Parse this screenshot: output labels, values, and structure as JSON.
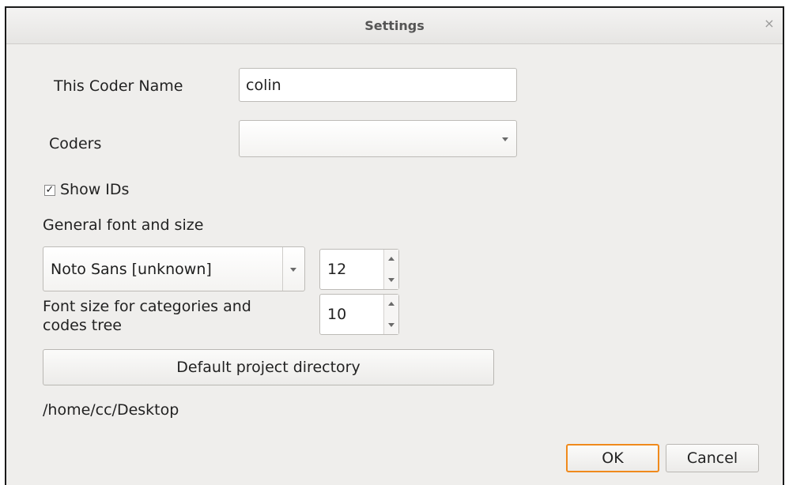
{
  "window": {
    "title": "Settings",
    "close_glyph": "×"
  },
  "coder_name": {
    "label": "This Coder Name",
    "value": "colin"
  },
  "coders": {
    "label": "Coders",
    "selected": ""
  },
  "show_ids": {
    "label": "Show IDs",
    "checked": true,
    "check_glyph": "✓"
  },
  "general_font": {
    "label": "General font and size",
    "font": "Noto Sans [unknown]",
    "size": "12"
  },
  "tree_font": {
    "label_line1": "Font size for categories and",
    "label_line2": "codes tree",
    "size": "10"
  },
  "project_dir": {
    "button_label": "Default project directory",
    "path": "/home/cc/Desktop"
  },
  "buttons": {
    "ok": "OK",
    "cancel": "Cancel"
  },
  "colors": {
    "default_button_border": "#f08a1c",
    "dialog_bg": "#efeeec"
  }
}
